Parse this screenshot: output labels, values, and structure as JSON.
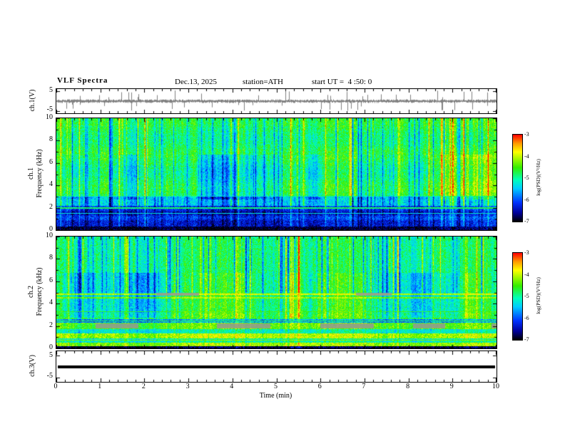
{
  "header": {
    "title": "VLF Spectra",
    "date": "Dec.13, 2025",
    "station": "station=ATH",
    "start_ut": "start UT =  4 :50: 0"
  },
  "panels": {
    "ch1_waveform": {
      "ylabel": "ch.1(V)",
      "ymax": "5",
      "ymin": "-5"
    },
    "ch1_spec": {
      "channel": "ch.1",
      "ylabel": "Frequency (kHz)",
      "yticks": [
        "10",
        "8",
        "6",
        "4",
        "2",
        "0"
      ]
    },
    "ch2_spec": {
      "channel": "ch.2",
      "ylabel": "Frequency (kHz)",
      "yticks": [
        "10",
        "8",
        "6",
        "4",
        "2",
        "0"
      ]
    },
    "ch3_waveform": {
      "ylabel": "ch.3(V)",
      "ymax": "5",
      "ymin": "-5"
    }
  },
  "xaxis": {
    "label": "Time (min)",
    "ticks": [
      "0",
      "1",
      "2",
      "3",
      "4",
      "5",
      "6",
      "7",
      "8",
      "9",
      "10"
    ]
  },
  "colorbar": {
    "label": "log(PSD)(V²/Hz)",
    "ticks": [
      "-3",
      "-4",
      "-5",
      "-6",
      "-7"
    ],
    "gradient": [
      {
        "color": "#ff0000",
        "pos": 0
      },
      {
        "color": "#ff9900",
        "pos": 10
      },
      {
        "color": "#ffff00",
        "pos": 20
      },
      {
        "color": "#33ee00",
        "pos": 38
      },
      {
        "color": "#00ffbb",
        "pos": 52
      },
      {
        "color": "#00ccff",
        "pos": 62
      },
      {
        "color": "#0033ff",
        "pos": 78
      },
      {
        "color": "#000099",
        "pos": 90
      },
      {
        "color": "#000000",
        "pos": 100
      }
    ]
  },
  "chart_data": [
    {
      "type": "line",
      "name": "ch.1 waveform",
      "ylabel": "ch.1(V)",
      "ylim": [
        -5,
        5
      ],
      "xlim": [
        0,
        10
      ],
      "xlabel": "Time (min)",
      "description": "Dense broadband noise around 0 V with frequent impulsive sferic spikes reaching approximately ±5 V throughout the 10-minute record."
    },
    {
      "type": "heatmap",
      "name": "ch.1 spectrogram",
      "ylabel": "ch.1 Frequency (kHz)",
      "ylim": [
        0,
        10
      ],
      "xlim": [
        0,
        10
      ],
      "value_label": "log(PSD)(V²/Hz)",
      "value_range": [
        -7,
        -3
      ],
      "description": "VLF spectrogram: green/cyan broadband background above ~3 kHz with many vertical bright (yellow/red) sferic streaks and dark blue quiet columns; dark blue band 0.5–2.2 kHz; near-black band below ~0.4 kHz; faint horizontal lines near 1.6, 2.0 and 3 kHz.",
      "legend_position": "right",
      "grid": false
    },
    {
      "type": "heatmap",
      "name": "ch.2 spectrogram",
      "ylabel": "ch.2 Frequency (kHz)",
      "ylim": [
        0,
        10
      ],
      "xlim": [
        0,
        10
      ],
      "value_label": "log(PSD)(V²/Hz)",
      "value_range": [
        -7,
        -3
      ],
      "description": "VLF spectrogram: green background with strong blue vertical streaks above ~5 kHz; bright yellow/green horizontal banding below ~2.5 kHz with gray dropout patches near 2 kHz; orange horizontal interference lines near 4.6–4.9 kHz; near-black band below ~0.25 kHz.",
      "legend_position": "right",
      "grid": false
    },
    {
      "type": "line",
      "name": "ch.3 waveform",
      "ylabel": "ch.3(V)",
      "ylim": [
        -5,
        5
      ],
      "xlim": [
        0,
        10
      ],
      "description": "Flat thick line at 0 V for the entire record (channel inactive)."
    }
  ]
}
